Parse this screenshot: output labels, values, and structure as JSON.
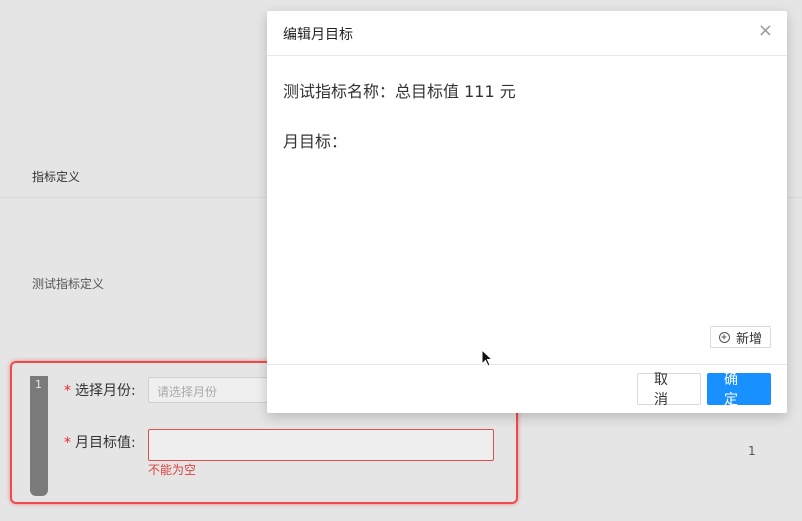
{
  "background": {
    "column_header": "指标定义",
    "row_text": "测试指标定义",
    "count": "1"
  },
  "form_row": {
    "index": "1",
    "month_label": "选择月份:",
    "month_placeholder": "请选择月份",
    "target_label": "月目标值:",
    "required_mark": "*",
    "error": "不能为空"
  },
  "modal": {
    "title": "编辑月目标",
    "close": "×",
    "metric_line": "测试指标名称：总目标值 111 元",
    "month_target_label": "月目标：",
    "add_label": "新增",
    "cancel_label": "取消",
    "ok_label": "确定"
  },
  "colors": {
    "primary": "#1890ff",
    "error": "#f5222d",
    "highlight": "#f04b4b"
  }
}
